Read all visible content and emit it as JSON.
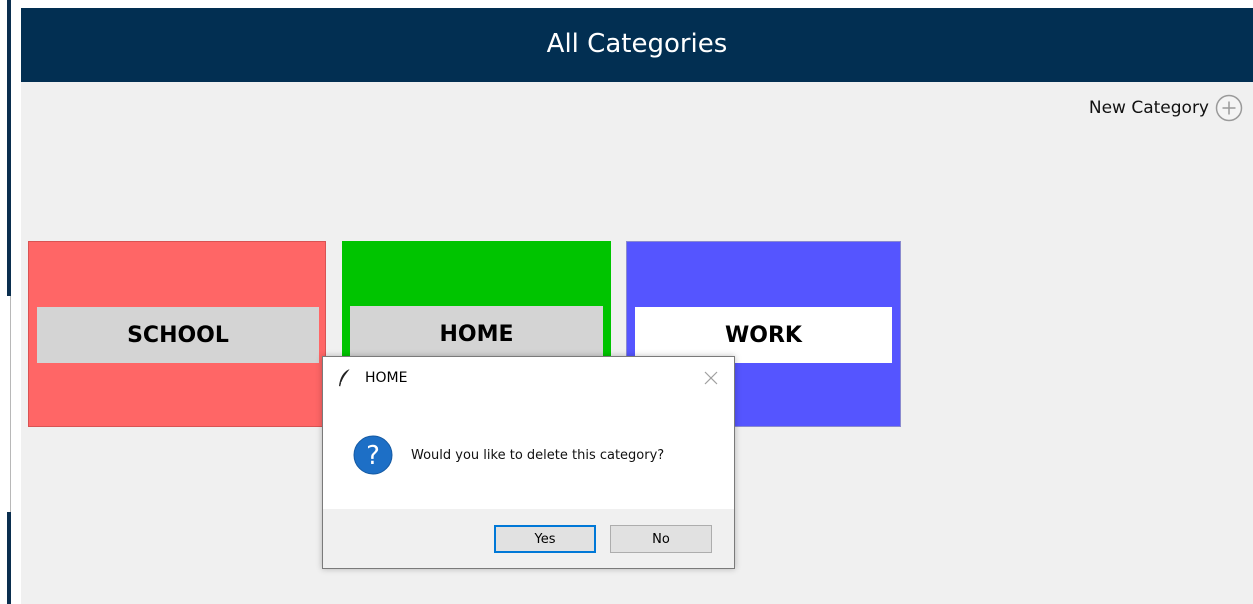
{
  "header": {
    "title": "All Categories"
  },
  "toolbar": {
    "new_category_label": "New Category",
    "new_category_icon": "plus-circle-icon"
  },
  "categories": [
    {
      "label": "SCHOOL",
      "color": "#ff6666"
    },
    {
      "label": "HOME",
      "color": "#00c400"
    },
    {
      "label": "WORK",
      "color": "#5555ff"
    }
  ],
  "dialog": {
    "title": "HOME",
    "title_icon": "feather-icon",
    "message": "Would you like to delete this category?",
    "message_icon": "question-icon",
    "yes_label": "Yes",
    "no_label": "No"
  },
  "colors": {
    "header_bg": "#022f52",
    "app_bg": "#f0f0f0",
    "dialog_focus": "#0078d7",
    "question_blue": "#1d6fc6"
  }
}
